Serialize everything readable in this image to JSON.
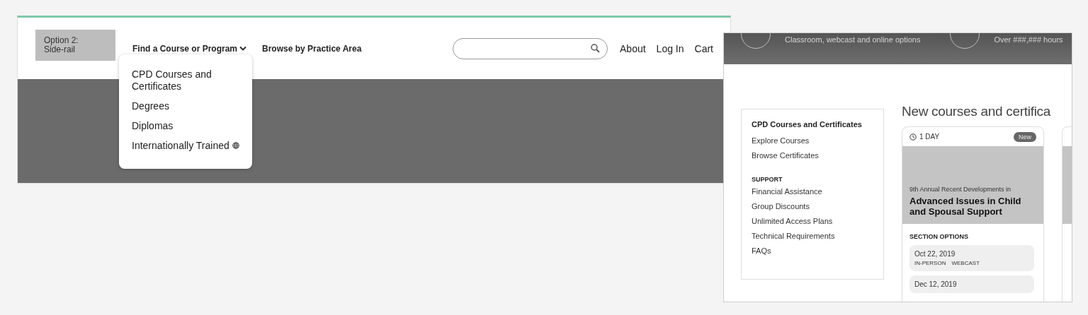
{
  "header_mockup": {
    "option_label": "Option 2: Side-rail",
    "nav": [
      {
        "label": "Find a Course or Program",
        "kind": "dropdown",
        "expanded": true
      },
      {
        "label": "Browse by Practice Area",
        "kind": "link"
      }
    ],
    "utility_links": [
      "About",
      "Log In",
      "Cart"
    ],
    "dropdown": [
      {
        "label": "CPD Courses and Certificates",
        "kind": "link"
      },
      {
        "label": "Degrees",
        "kind": "link"
      },
      {
        "label": "Diplomas",
        "kind": "link"
      },
      {
        "label": "Internationally Trained",
        "kind": "international"
      }
    ]
  },
  "page_mockup": {
    "banner": [
      "Classroom, webcast and online options",
      "Over ###,### hours"
    ],
    "sidebar": {
      "title": "CPD Courses and Certificates",
      "items": [
        "Explore Courses",
        "Browse Certificates"
      ],
      "sections": [
        {
          "heading": "SUPPORT",
          "items": [
            "Financial Assistance",
            "Group Discounts",
            "Unlimited Access Plans",
            "Technical Requirements",
            "FAQs"
          ]
        }
      ]
    },
    "heading": "New courses and certifica",
    "cards": [
      {
        "duration": "1 DAY",
        "badge": "New",
        "eyebrow": "9th Annual Recent Developments in",
        "title": "Advanced Issues in Child and Spousal Support",
        "options_label": "SECTION OPTIONS",
        "options": [
          {
            "date": "Oct 22, 2019",
            "formats": [
              "IN-PERSON",
              "WEBCAST"
            ]
          },
          {
            "date": "Dec 12, 2019"
          }
        ]
      }
    ]
  }
}
